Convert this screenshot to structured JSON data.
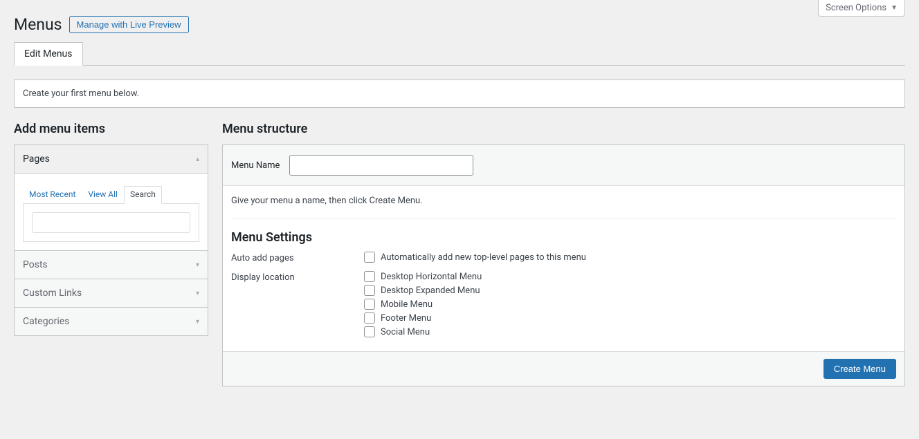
{
  "screen_options": "Screen Options",
  "page_title": "Menus",
  "live_preview_btn": "Manage with Live Preview",
  "tabs": {
    "edit_menus": "Edit Menus"
  },
  "notice": "Create your first menu below.",
  "left": {
    "heading": "Add menu items",
    "panels": {
      "pages": "Pages",
      "posts": "Posts",
      "custom_links": "Custom Links",
      "categories": "Categories"
    },
    "inner_tabs": {
      "most_recent": "Most Recent",
      "view_all": "View All",
      "search": "Search"
    }
  },
  "right": {
    "heading": "Menu structure",
    "menu_name_label": "Menu Name",
    "menu_name_value": "",
    "instructions": "Give your menu a name, then click Create Menu.",
    "settings_title": "Menu Settings",
    "auto_add_label": "Auto add pages",
    "auto_add_option": "Automatically add new top-level pages to this menu",
    "display_location_label": "Display location",
    "locations": [
      "Desktop Horizontal Menu",
      "Desktop Expanded Menu",
      "Mobile Menu",
      "Footer Menu",
      "Social Menu"
    ],
    "create_btn": "Create Menu"
  }
}
